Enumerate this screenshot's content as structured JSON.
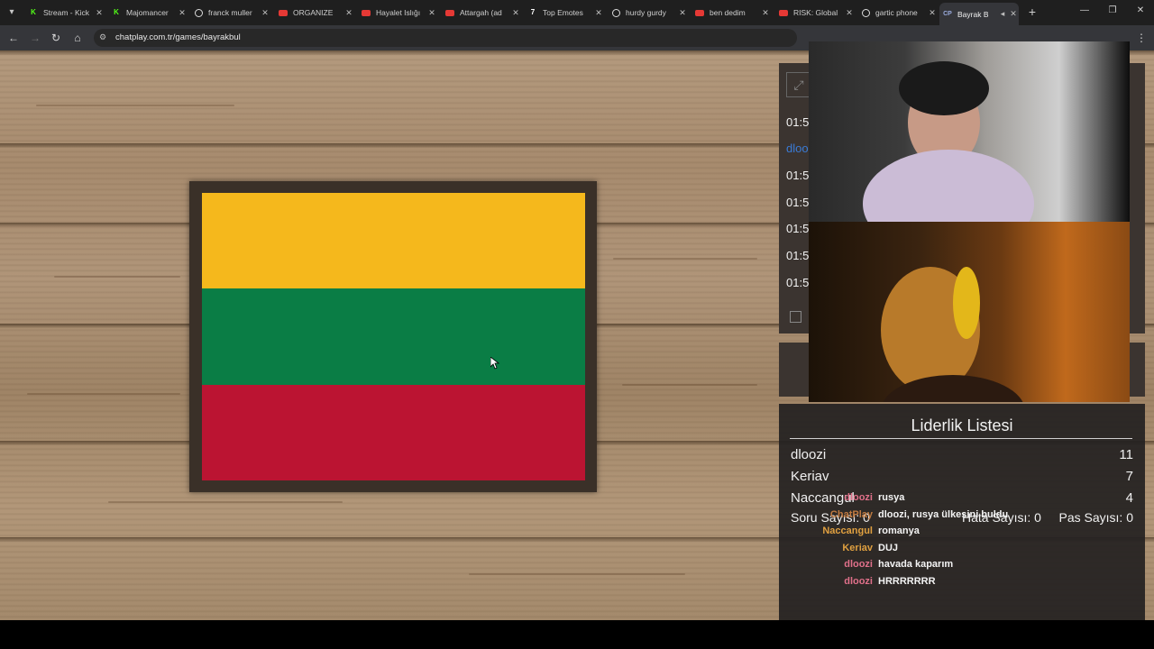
{
  "browser": {
    "tabs": [
      {
        "title": "Stream - Kick",
        "icon": "kick-icon"
      },
      {
        "title": "Majomancer",
        "icon": "kick-icon"
      },
      {
        "title": "franck muller",
        "icon": "google-icon"
      },
      {
        "title": "ORGANIZE",
        "icon": "youtube-icon"
      },
      {
        "title": "Hayalet Islığı",
        "icon": "youtube-icon"
      },
      {
        "title": "Attargah (ad",
        "icon": "youtube-icon"
      },
      {
        "title": "Top Emotes",
        "icon": "7tv-icon"
      },
      {
        "title": "hurdy gurdy",
        "icon": "google-icon"
      },
      {
        "title": "ben dedim",
        "icon": "youtube-icon"
      },
      {
        "title": "RISK: Global",
        "icon": "youtube-icon"
      },
      {
        "title": "gartic phone",
        "icon": "google-icon"
      },
      {
        "title": "Bayrak B",
        "icon": "chatplay-icon",
        "active": true
      }
    ],
    "url": "chatplay.com.tr/games/bayrakbul"
  },
  "game": {
    "flag_colors": [
      "#f5b81c",
      "#0a7d45",
      "#bb1432"
    ]
  },
  "panel": {
    "time_rows": [
      {
        "text": "01:5",
        "user": false
      },
      {
        "text": "dloo",
        "user": true
      },
      {
        "text": "01:5",
        "user": false
      },
      {
        "text": "01:5",
        "user": false
      },
      {
        "text": "01:5",
        "user": false
      },
      {
        "text": "01:5",
        "user": false
      },
      {
        "text": "01:5",
        "user": false
      }
    ]
  },
  "leaderboard": {
    "title": "Liderlik Listesi",
    "rows": [
      {
        "name": "dloozi",
        "score": "11"
      },
      {
        "name": "Keriav",
        "score": "7"
      },
      {
        "name": "Naccangul",
        "score": "4"
      }
    ],
    "stats": {
      "soru": "Soru Sayısı: 0",
      "hata": "Hata Sayısı: 0",
      "pas": "Pas Sayısı: 0"
    }
  },
  "chat": [
    {
      "user": "dloozi",
      "color": "#e0708a",
      "message": "rusya"
    },
    {
      "user": "ChatPlay",
      "color": "#c07a40",
      "message": "dloozi, rusya ülkesini buldu"
    },
    {
      "user": "Naccangul",
      "color": "#e0a040",
      "message": "romanya"
    },
    {
      "user": "Keriav",
      "color": "#e0a040",
      "message": "DUJ"
    },
    {
      "user": "dloozi",
      "color": "#e0708a",
      "message": "havada kaparım"
    },
    {
      "user": "dloozi",
      "color": "#e0708a",
      "message": "HRRRRRRR"
    }
  ]
}
